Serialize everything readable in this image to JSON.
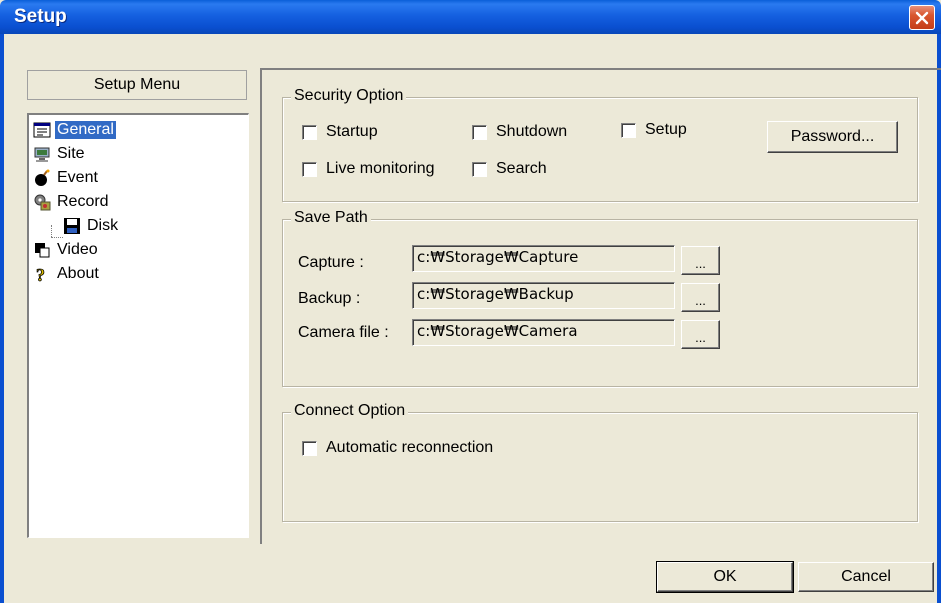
{
  "window": {
    "title": "Setup"
  },
  "sidebar": {
    "header": "Setup Menu",
    "items": [
      {
        "label": "General",
        "icon": "general-icon",
        "selected": true
      },
      {
        "label": "Site",
        "icon": "site-icon"
      },
      {
        "label": "Event",
        "icon": "event-icon"
      },
      {
        "label": "Record",
        "icon": "record-icon"
      },
      {
        "label": "Disk",
        "icon": "disk-icon",
        "child_of": "Record"
      },
      {
        "label": "Video",
        "icon": "video-icon"
      },
      {
        "label": "About",
        "icon": "about-icon"
      }
    ]
  },
  "security": {
    "title": "Security Option",
    "startup": "Startup",
    "shutdown": "Shutdown",
    "setup": "Setup",
    "live_monitoring": "Live monitoring",
    "search": "Search",
    "password_button": "Password..."
  },
  "save_path": {
    "title": "Save Path",
    "capture_label": "Capture :",
    "capture_value": "c:₩Storage₩Capture",
    "backup_label": "Backup :",
    "backup_value": "c:₩Storage₩Backup",
    "camera_label": "Camera file :",
    "camera_value": "c:₩Storage₩Camera",
    "browse_label": "..."
  },
  "connect": {
    "title": "Connect Option",
    "auto_reconnect": "Automatic reconnection"
  },
  "footer": {
    "ok": "OK",
    "cancel": "Cancel"
  },
  "colors": {
    "titlebar": "#0a5fd8",
    "selection": "#316ac5",
    "dialog_bg": "#ece9d8",
    "close": "#d9562f"
  }
}
